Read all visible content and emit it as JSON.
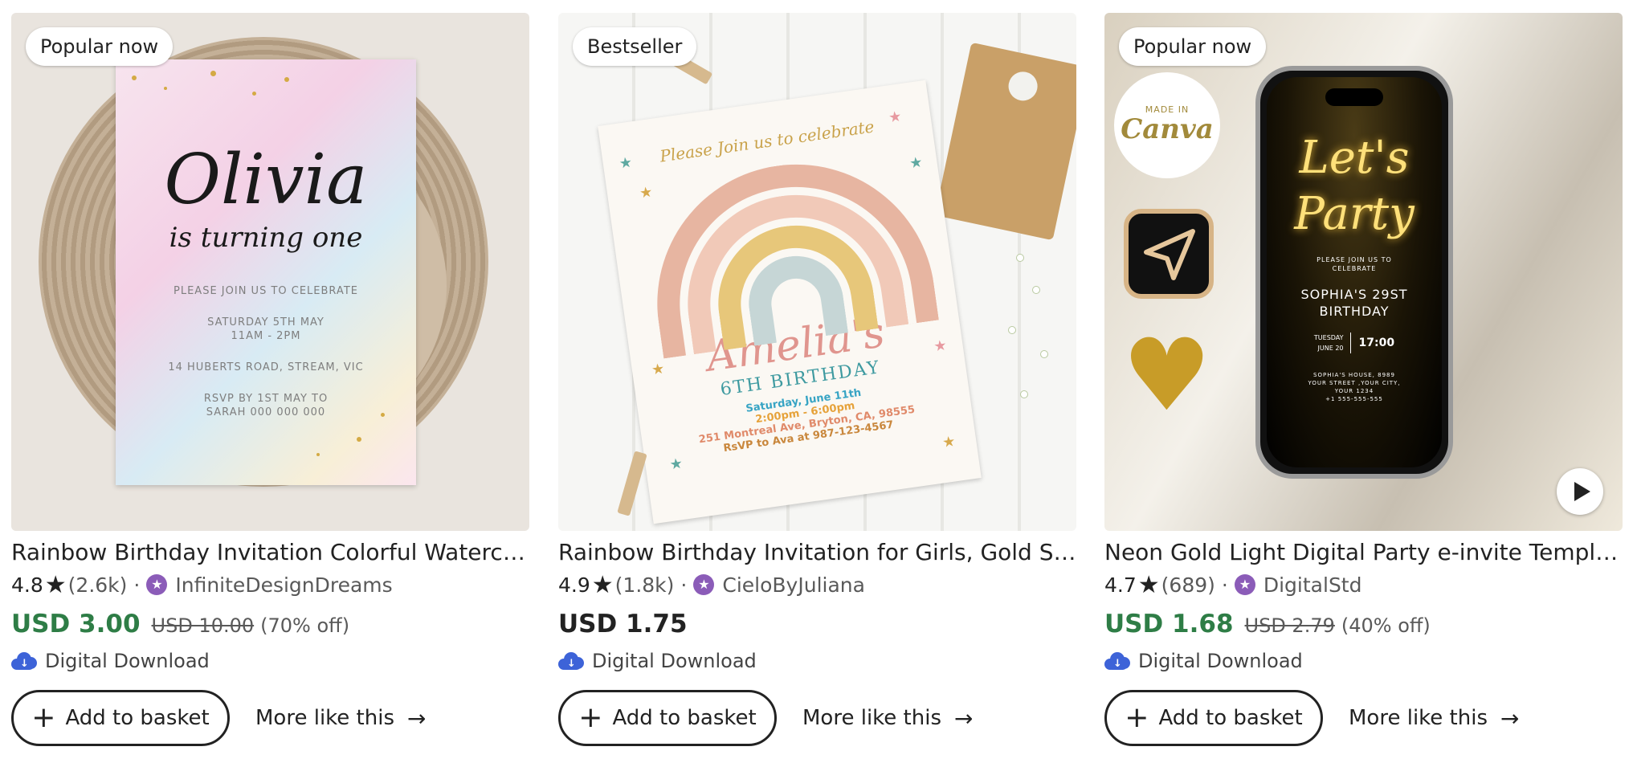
{
  "colors": {
    "sale_price": "#2e7d46",
    "text": "#222222",
    "muted": "#595959",
    "verified_badge": "#8b5cb8",
    "download_icon": "#3d63d8"
  },
  "listings": [
    {
      "badge": "Popular now",
      "image_text": {
        "name": "Olivia",
        "subtitle": "is turning one",
        "line1": "PLEASE JOIN US TO CELEBRATE",
        "line2": "SATURDAY 5TH MAY",
        "line3": "11AM - 2PM",
        "line4": "14 HUBERTS ROAD, STREAM, VIC",
        "line5": "RSVP BY 1ST MAY TO",
        "line6": "SARAH 000 000 000"
      },
      "title": "Rainbow Birthday Invitation Colorful Watercolor Birthday Invite",
      "rating": "4.8",
      "review_count": "(2.6k)",
      "separator": "·",
      "shop": "InfiniteDesignDreams",
      "price": "USD 3.00",
      "original_price": "USD 10.00",
      "discount": "(70% off)",
      "download_label": "Digital Download",
      "add_label": "Add to basket",
      "more_label": "More like this"
    },
    {
      "badge": "Bestseller",
      "image_text": {
        "header": "Please Join us to celebrate",
        "name": "Amelia's",
        "birthday": "6TH BIRTHDAY",
        "date": "Saturday, June 11th",
        "time": "2:00pm - 6:00pm",
        "address": "251 Montreal Ave, Bryton, CA, 98555",
        "rsvp": "RsVP to Ava at 987-123-4567"
      },
      "title": "Rainbow Birthday Invitation for Girls, Gold Stars Printable",
      "rating": "4.9",
      "review_count": "(1.8k)",
      "separator": "·",
      "shop": "CieloByJuliana",
      "price": "USD 1.75",
      "download_label": "Digital Download",
      "add_label": "Add to basket",
      "more_label": "More like this"
    },
    {
      "badge": "Popular now",
      "image_text": {
        "made_in": "MADE IN",
        "canva": "Canva",
        "headline": "Let's Party",
        "join": "PLEASE JOIN US TO",
        "celebrate": "CELEBRATE",
        "event": "SOPHIA'S 29ST BIRTHDAY",
        "day": "TUESDAY",
        "date": "JUNE 20",
        "time": "17:00",
        "addr1": "SOPHIA'S HOUSE, 8989",
        "addr2": "YOUR STREET ,YOUR CITY,",
        "addr3": "YOUR 1234",
        "addr4": "+1 555-555-555"
      },
      "title": "Neon Gold Light Digital Party e-invite Template",
      "rating": "4.7",
      "review_count": "(689)",
      "separator": "·",
      "shop": "DigitalStd",
      "price": "USD 1.68",
      "original_price": "USD 2.79",
      "discount": "(40% off)",
      "download_label": "Digital Download",
      "add_label": "Add to basket",
      "more_label": "More like this"
    }
  ]
}
